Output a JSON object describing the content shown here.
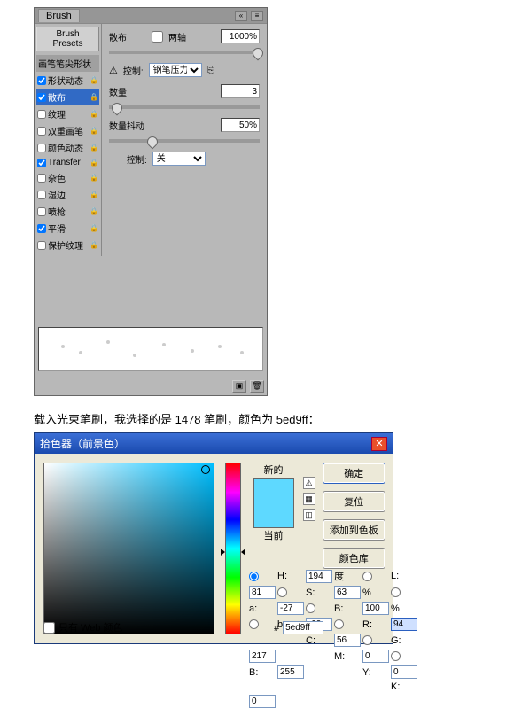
{
  "brush_panel": {
    "title": "Brush",
    "presets_btn": "Brush Presets",
    "top_toggle_label": "散布",
    "two_axis_label": "两轴",
    "spacing_value": "1000%",
    "control_label": "控制:",
    "control_value": "钢笔压力",
    "count_label": "数量",
    "count_value": "3",
    "jitter_label": "数量抖动",
    "jitter_value": "50%",
    "control2_label": "控制:",
    "control2_value": "关",
    "items": [
      {
        "label": "画笔笔尖形状",
        "header": true
      },
      {
        "label": "形状动态",
        "checked": true,
        "lock": true
      },
      {
        "label": "散布",
        "checked": true,
        "selected": true,
        "lock": true
      },
      {
        "label": "纹理",
        "checked": false,
        "lock": true
      },
      {
        "label": "双重画笔",
        "checked": false,
        "lock": true
      },
      {
        "label": "颜色动态",
        "checked": false,
        "lock": true
      },
      {
        "label": "Transfer",
        "checked": true,
        "lock": true
      },
      {
        "label": "杂色",
        "checked": false,
        "lock": true
      },
      {
        "label": "湿边",
        "checked": false,
        "lock": true
      },
      {
        "label": "喷枪",
        "checked": false,
        "lock": true
      },
      {
        "label": "平滑",
        "checked": true,
        "lock": true
      },
      {
        "label": "保护纹理",
        "checked": false,
        "lock": true
      }
    ]
  },
  "caption": "载入光束笔刷，我选择的是 1478 笔刷，颜色为 5ed9ff：",
  "picker": {
    "title": "拾色器（前景色）",
    "new_label": "新的",
    "current_label": "当前",
    "ok": "确定",
    "cancel": "复位",
    "add_swatch": "添加到色板",
    "libraries": "颜色库",
    "webonly": "只有 Web 颜色",
    "h": {
      "lbl": "H:",
      "val": "194",
      "unit": "度"
    },
    "s": {
      "lbl": "S:",
      "val": "63",
      "unit": "%"
    },
    "b": {
      "lbl": "B:",
      "val": "100",
      "unit": "%"
    },
    "r": {
      "lbl": "R:",
      "val": "94"
    },
    "g": {
      "lbl": "G:",
      "val": "217"
    },
    "bl": {
      "lbl": "B:",
      "val": "255"
    },
    "l": {
      "lbl": "L:",
      "val": "81"
    },
    "a": {
      "lbl": "a:",
      "val": "-27"
    },
    "bb": {
      "lbl": "b:",
      "val": "-29"
    },
    "c": {
      "lbl": "C:",
      "val": "56",
      "unit": "%"
    },
    "m": {
      "lbl": "M:",
      "val": "0",
      "unit": "%"
    },
    "y": {
      "lbl": "Y:",
      "val": "0",
      "unit": "%"
    },
    "k": {
      "lbl": "K:",
      "val": "0",
      "unit": "%"
    },
    "hex_lbl": "#",
    "hex": "5ed9ff"
  }
}
